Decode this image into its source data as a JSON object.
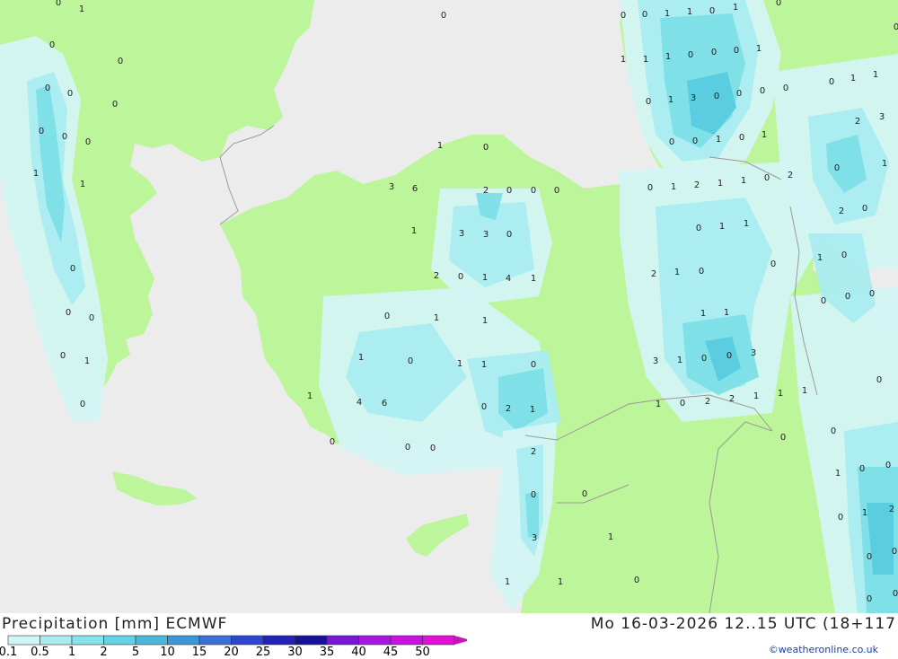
{
  "map": {
    "colors": {
      "sea": "#ececec",
      "land_dry": "#bdf59a",
      "light_precip": "#d4f4f4",
      "precip_01": "#a9ecef",
      "precip_05": "#7ddfe6",
      "precip_1": "#58cbe0",
      "precip_2": "#3aa6da",
      "border": "#9a9a9a"
    },
    "values": [
      "0",
      "1",
      "0",
      "0",
      "0",
      "1",
      "1",
      "0",
      "1",
      "0",
      "0",
      "0",
      "0",
      "1",
      "1",
      "1",
      "0",
      "0",
      "0",
      "1",
      "1",
      "1",
      "0",
      "0",
      "0",
      "0",
      "1",
      "3",
      "0",
      "0",
      "0",
      "0",
      "0",
      "0",
      "0",
      "0",
      "0",
      "0",
      "1",
      "0",
      "1",
      "2",
      "3",
      "1",
      "1",
      "1",
      "0",
      "0",
      "1",
      "2",
      "1",
      "1",
      "0",
      "2",
      "0",
      "1",
      "3",
      "6",
      "2",
      "0",
      "0",
      "0",
      "2",
      "0",
      "1",
      "3",
      "3",
      "0",
      "0",
      "1",
      "1",
      "1",
      "0",
      "0",
      "2",
      "0",
      "1",
      "4",
      "1",
      "2",
      "1",
      "0",
      "0",
      "0",
      "0",
      "0",
      "1",
      "1",
      "1",
      "1",
      "0",
      "0",
      "0",
      "0",
      "1",
      "1",
      "0",
      "1",
      "1",
      "0",
      "3",
      "1",
      "0",
      "0",
      "3",
      "0",
      "1",
      "4",
      "6",
      "0",
      "2",
      "1",
      "1",
      "0",
      "2",
      "2",
      "1",
      "1",
      "1",
      "0",
      "0",
      "0",
      "0",
      "2",
      "0",
      "0",
      "0",
      "0",
      "1",
      "0",
      "0",
      "3",
      "1",
      "0",
      "1",
      "2",
      "1",
      "1",
      "0",
      "0",
      "0",
      "0",
      "0",
      "1",
      "0",
      "0",
      "0",
      "1",
      "1",
      "1",
      "1",
      "0",
      "0",
      "1",
      "1",
      "1",
      "3",
      "0",
      "0",
      "2",
      "1",
      "0",
      "1",
      "0",
      "0",
      "3"
    ]
  },
  "footer": {
    "title": "Precipitation [mm] ECMWF",
    "datetime": "Mo 16-03-2026 12..15 UTC (18+117",
    "credit": "©weatheronline.co.uk",
    "scale": {
      "labels": [
        "0.1",
        "0.5",
        "1",
        "2",
        "5",
        "10",
        "15",
        "20",
        "25",
        "30",
        "35",
        "40",
        "45",
        "50"
      ],
      "colors": [
        "#d0f5f5",
        "#a9ecef",
        "#86e3ea",
        "#64d2e4",
        "#4ab8dd",
        "#3a98d8",
        "#3a6fd6",
        "#2d45d0",
        "#2222b8",
        "#14139a",
        "#7a16d8",
        "#a616e0",
        "#c812e0",
        "#e010d8",
        "#c019b6"
      ]
    }
  }
}
